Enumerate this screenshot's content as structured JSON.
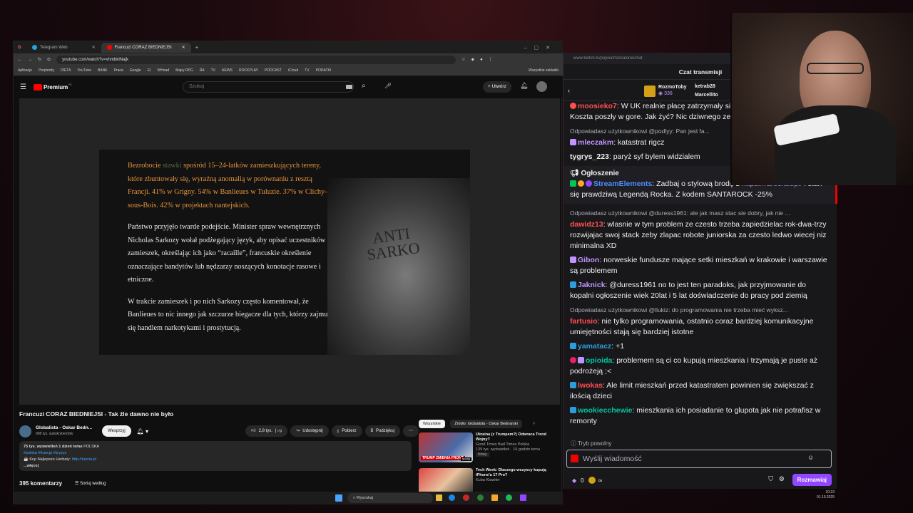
{
  "browser": {
    "tabs": [
      {
        "label": "Telegram Web",
        "color": "#2aa3d8"
      },
      {
        "label": "Francuzi CORAZ BIEDNIEJSI",
        "color": "#ff0000"
      }
    ],
    "url": "youtube.com/watch?v=xhmbkINajk",
    "bookmarks": [
      "Aplikacje",
      "Perplexity",
      "DIETA",
      "YouTube",
      "BANK",
      "Praca",
      "Google",
      "EI",
      "WHead",
      "Mapy RPG",
      "RA",
      "TV",
      "NEWS",
      "ROCKPLAY",
      "PODCAST",
      "iCloud",
      "TV",
      "PODATKI",
      "Wszystkie zakładki"
    ]
  },
  "youtube": {
    "logo": "Premium",
    "logo_sup": "PL",
    "search_placeholder": "Szukaj",
    "create_label": "Utwórz",
    "slide": {
      "p1_pre": "Bezrobocie",
      "p1_muted": "stawki",
      "p1_rest": "spośród 15–24-latków zamieszkujących tereny, które zbuntowały się, wyraźną anomalią w porównaniu z resztą Francji. 41% w Grigny. 54% w Banlieues w Tuluzie. 37% w Clichy-sous-Bois. 42% w projektach nantejskich.",
      "p2": "Państwo przyjęło twarde podejście. Minister spraw wewnętrznych Nicholas Sarkozy wołał podżegający język, aby opisać uczestników zamieszek, określając ich jako “racaille”, francuskie określenie oznaczające bandytów lub nędzarzy noszących konotacje rasowe i etniczne.",
      "p3": "W trakcie zamieszek i po nich Sarkozy często komentował, że Banlieues to nic innego jak szczurze biegacze dla tych, którzy zajmują się handlem narkotykami i prostytucją.",
      "photo_caption": "ANTI SARKO"
    },
    "title": "Francuzi CORAZ BIEDNIEJSI - Tak źle dawno nie było",
    "channel": "Globalista - Oskar Bedn...",
    "subscribers": "908 tys. subskrybentów",
    "support_label": "Wesprzyj",
    "likes": "2,8 tys.",
    "share_label": "Udostępnij",
    "download_label": "Pobierz",
    "thanks_label": "Podziękuj",
    "desc": {
      "views": "75 tys. wyświetleń",
      "age": "1 dzień temu",
      "country": "POLSKA",
      "tags": "#polska #francja #kryzys",
      "line": "Kup Najlepsze Herbaty:",
      "link": "http://tuncia.pl",
      "more": "...więcej"
    },
    "comments_count": "395 komentarzy",
    "sort_label": "Sortuj według",
    "chips": [
      "Wszystkie",
      "Źródło: Globalista - Oskar Bednarski"
    ],
    "recs": [
      {
        "title": "Ukraina (z Trumpem?) Odwraca Trend Wojny?",
        "channel": "Good Times Bad Times Polska",
        "meta": "139 tys. wyświetleń · 16 godzin temu",
        "badge": "Nowy",
        "duration": "20:00",
        "thumb": "TRUMP ZMIENIA FRONT"
      },
      {
        "title": "Tech Week: Dlaczego wszyscy kupują iPhone'a 17 Pro?",
        "channel": "Kuba Klawiter",
        "meta": "",
        "badge": "",
        "duration": "",
        "thumb": ""
      }
    ]
  },
  "taskbar": {
    "search_placeholder": "Wyszukaj",
    "time": "10:23",
    "date": "01.10.2025"
  },
  "chat": {
    "url": "www.twitch.tv/popout/rockalone/chat",
    "header": "Czat transmisji",
    "leaders": [
      {
        "name": "RozmoToby",
        "count": "336"
      },
      {
        "name": "ketrab28",
        "count": ""
      },
      {
        "name": "Marcellito",
        "count": ""
      }
    ],
    "messages": [
      {
        "reply": "",
        "user": "moosieko7",
        "color": "#ff4f4f",
        "text": "W UK realnie płacę zatrzymały się. Tygodniowo około 500£. Koszta poszły w gore. Jak żyć? Nic dziwnego ze kolejne kraje upadają"
      },
      {
        "reply": "Odpowiadasz użytkownikowi @podlyy: Pan jest fa...",
        "user": "mleczakm",
        "color": "#bf94ff",
        "text": "katastrat rigcz"
      },
      {
        "reply": "",
        "user": "tygrys_223",
        "color": "#efeff1",
        "text": "paryż syf bylem widzialem"
      }
    ],
    "announcement": {
      "label": "Ogłoszenie",
      "user": "StreamElements",
      "text1": "Zadbaj o stylową brodę z",
      "link": "https://rarecraft.pl/",
      "text2": "i stań się prawdziwą Legendą Rocka. Z kodem SANTAROCK -25%"
    },
    "messages2": [
      {
        "reply": "Odpowiadasz użytkownikowi @duress1961: ale jak masz stac sie dobry, jak nie ...",
        "user": "dawidz13",
        "color": "#ff4f4f",
        "text": "wlasnie w tym problem ze czesto trzeba zapiedzielac rok-dwa-trzy rozwijajac swoj stack zeby zlapac robote juniorska za czesto ledwo wiecej niz minimalna XD"
      },
      {
        "reply": "",
        "user": "Gibon",
        "color": "#bf94ff",
        "text": "norweskie fundusze mające setki mieszkań w krakowie i warszawie są problemem"
      },
      {
        "reply": "",
        "user": "Jaknick",
        "color": "#bf94ff",
        "text": "@duress1961 no to jest ten paradoks, jak przyjmowanie do kopalni ogłoszenie wiek 20lat i 5 lat doświadczenie do pracy pod ziemią"
      },
      {
        "reply": "Odpowiadasz użytkownikowi @llukiz: do programowania nie trzeba mieć wyksz...",
        "user": "fartusio",
        "color": "#ff4f4f",
        "text": "nie tylko programowania, ostatnio coraz bardziej komunikacyjne umiejętności stają się bardziej istotne"
      },
      {
        "reply": "",
        "user": "yamatacz",
        "color": "#2d9cdb",
        "text": "+1"
      },
      {
        "reply": "",
        "user": "opioida",
        "color": "#00c8a0",
        "text": "problemem są ci co kupują mieszkania i trzymają je puste aż podrożeją ;<"
      },
      {
        "reply": "",
        "user": "lwokas",
        "color": "#ff4f4f",
        "text": "Ale limit mieszkań przed katastratem powinien się zwiększać z ilością dzieci"
      },
      {
        "reply": "",
        "user": "wookiecchewie",
        "color": "#00c8a0",
        "text": "mieszkania ich posiadanie to glupota jak nie potrafisz w remonty"
      }
    ],
    "slow_mode": "Tryb powolny",
    "input_placeholder": "Wyślij wiadomość",
    "points": "0",
    "chat_button": "Rozmawiaj"
  }
}
